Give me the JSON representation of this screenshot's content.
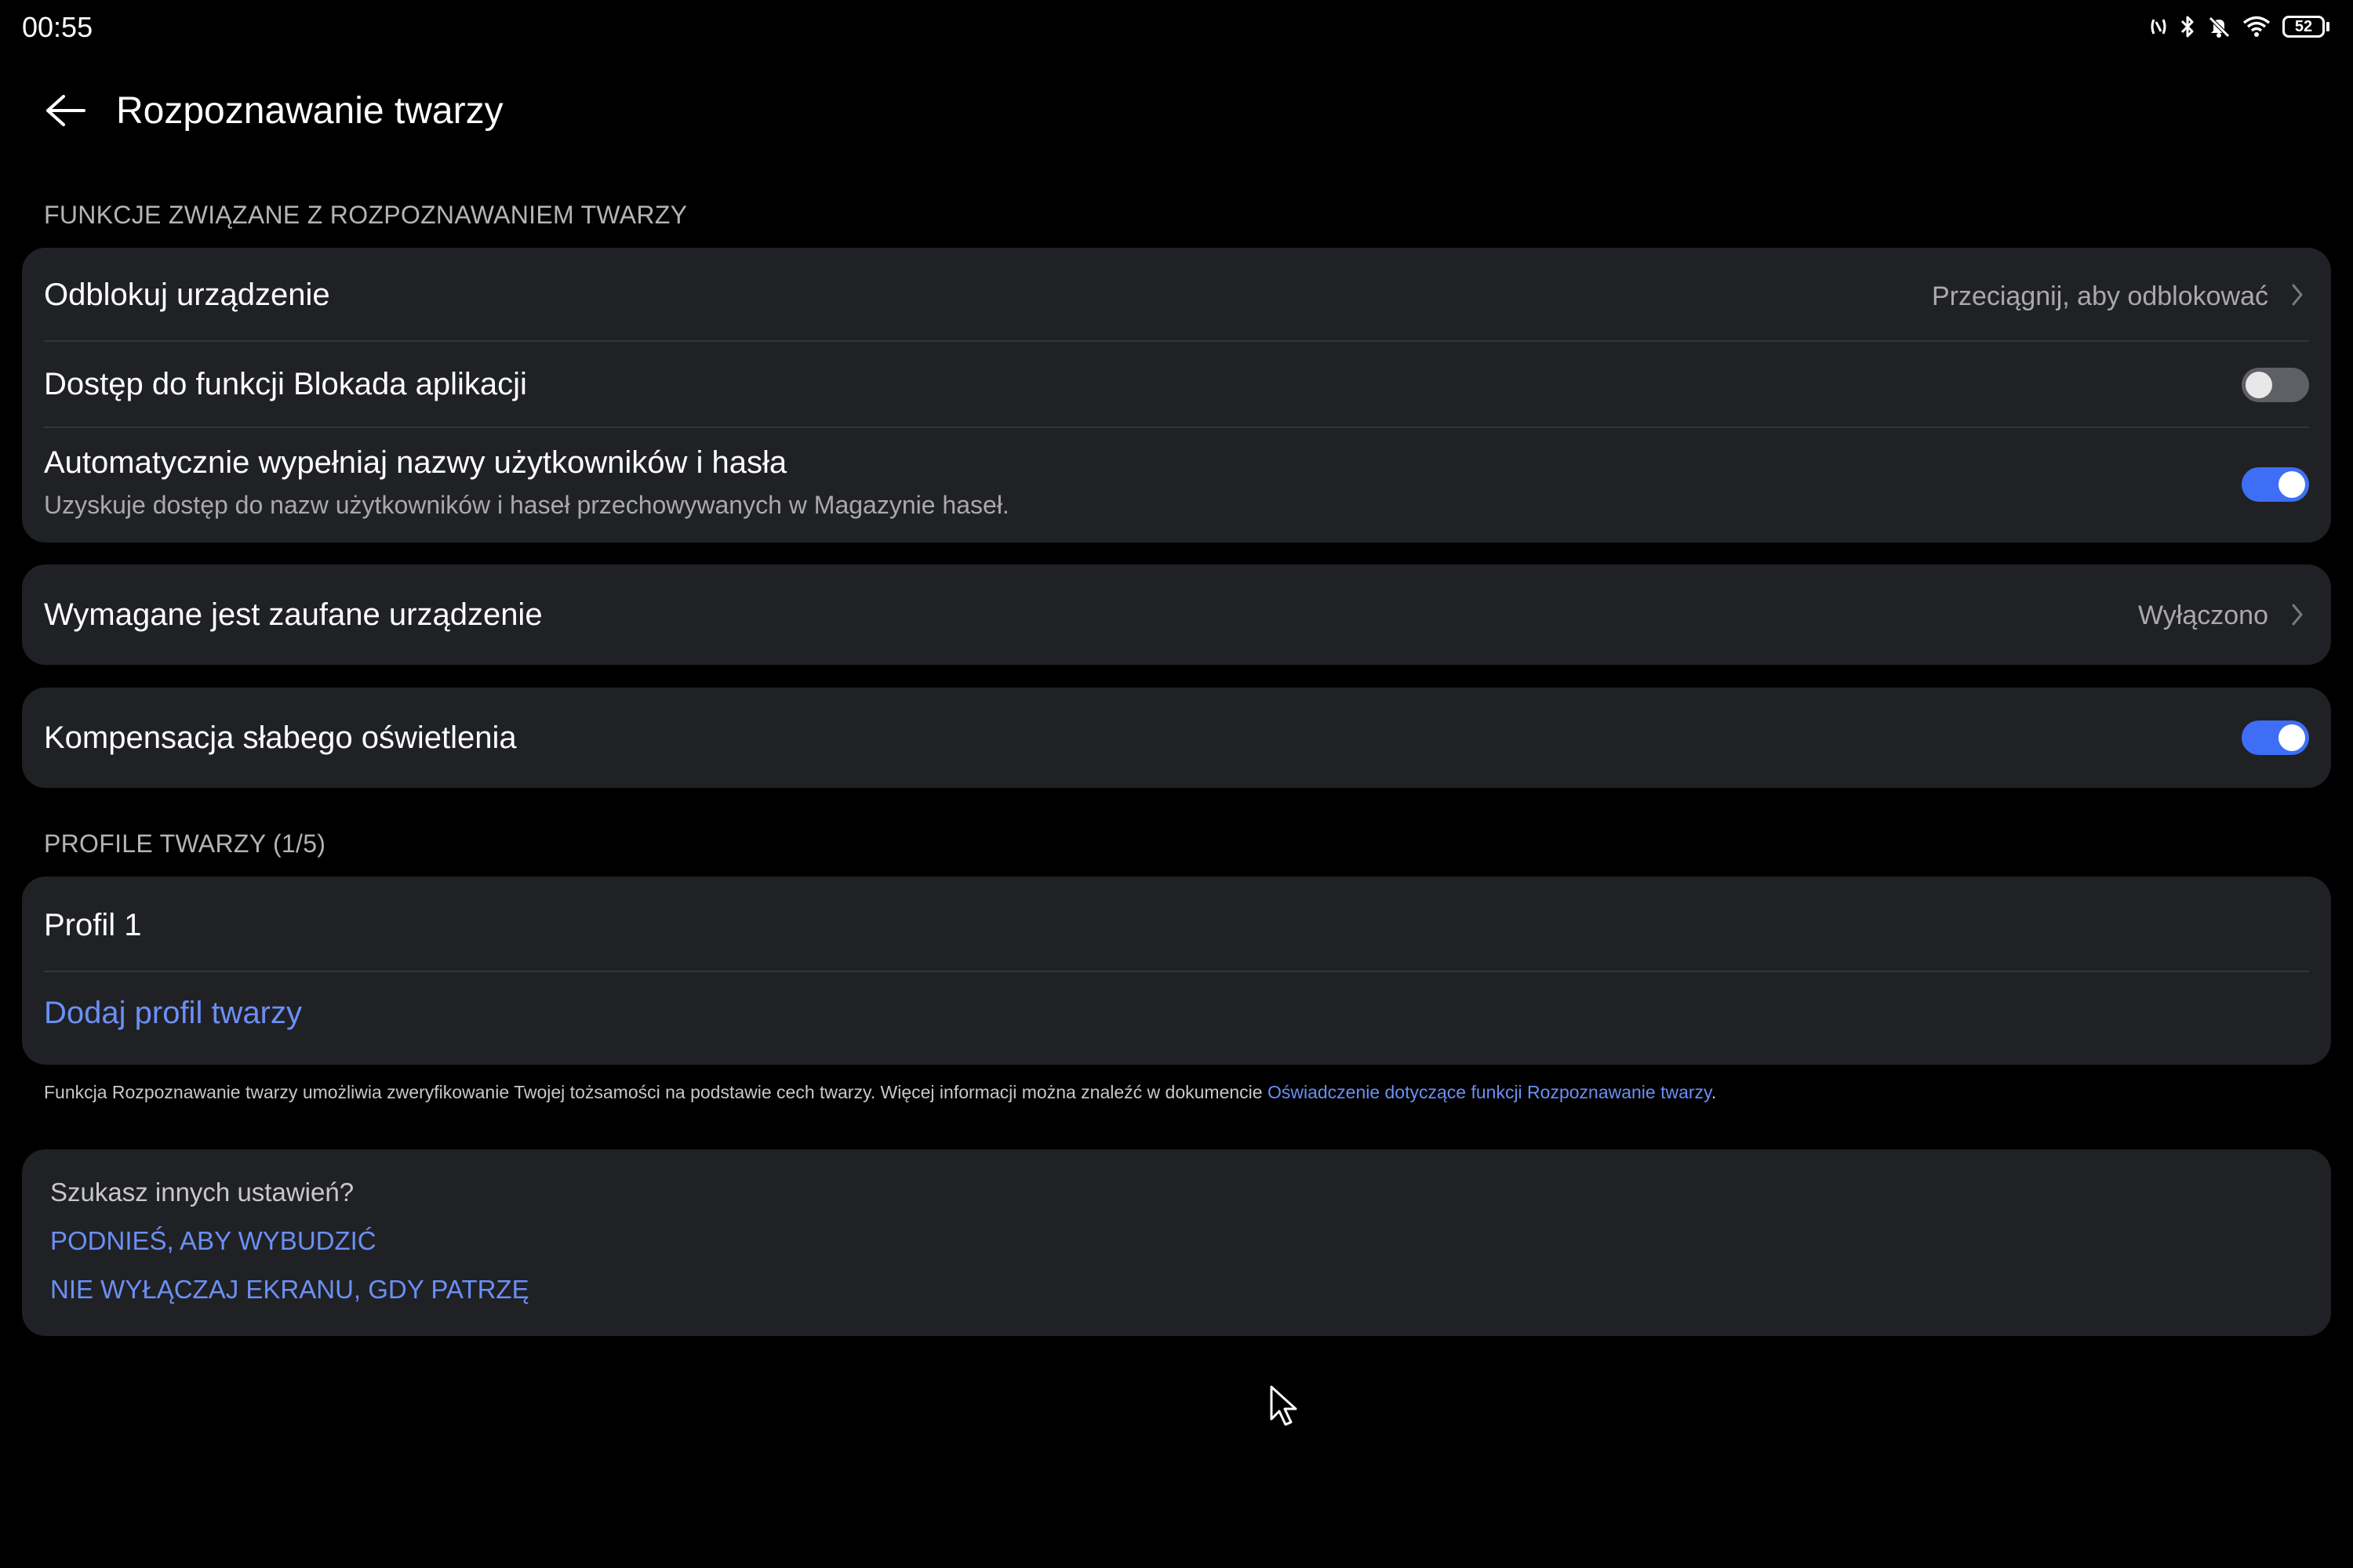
{
  "status_bar": {
    "time": "00:55",
    "icons": [
      "nfc-icon",
      "bluetooth-icon",
      "mute-icon",
      "wifi-icon"
    ],
    "battery": "52"
  },
  "header": {
    "back_icon": "back-arrow-icon",
    "title": "Rozpoznawanie twarzy"
  },
  "section_features": {
    "label": "FUNKCJE ZWIĄZANE Z ROZPOZNAWANIEM TWARZY",
    "unlock": {
      "title": "Odblokuj urządzenie",
      "value": "Przeciągnij, aby odblokować"
    },
    "app_lock": {
      "title": "Dostęp do funkcji Blokada aplikacji",
      "enabled": false
    },
    "autofill": {
      "title": "Automatycznie wypełniaj nazwy użytkowników i hasła",
      "subtitle": "Uzyskuje dostęp do nazw użytkowników i haseł przechowywanych w Magazynie haseł.",
      "enabled": true
    }
  },
  "trusted_device": {
    "title": "Wymagane jest zaufane urządzenie",
    "value": "Wyłączono"
  },
  "low_light": {
    "title": "Kompensacja słabego oświetlenia",
    "enabled": true
  },
  "section_profiles": {
    "label": "PROFILE TWARZY (1/5)",
    "profiles": [
      "Profil 1"
    ],
    "add_label": "Dodaj profil twarzy"
  },
  "footnote": {
    "text": "Funkcja Rozpoznawanie twarzy umożliwia zweryfikowanie Twojej tożsamości na podstawie cech twarzy. Więcej informacji można znaleźć w dokumencie ",
    "link": "Oświadczenie dotyczące funkcji Rozpoznawanie twarzy",
    "end": "."
  },
  "other_settings": {
    "question": "Szukasz innych ustawień?",
    "links": [
      "PODNIEŚ, ABY WYBUDZIĆ",
      "NIE WYŁĄCZAJ EKRANU, GDY PATRZĘ"
    ]
  },
  "colors": {
    "background": "#000000",
    "card": "#202124",
    "accent": "#3d6ef5",
    "link": "#6b8ff5"
  }
}
